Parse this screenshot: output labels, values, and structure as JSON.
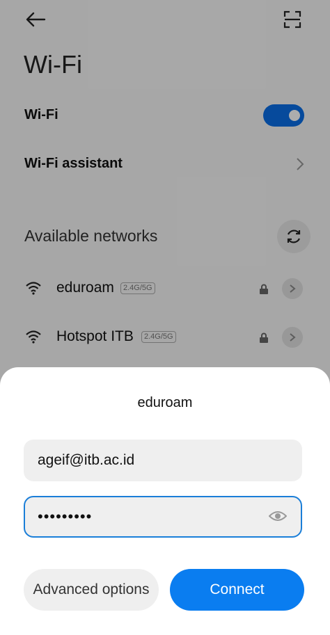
{
  "header": {
    "title": "Wi-Fi"
  },
  "settings": {
    "wifi_label": "Wi-Fi",
    "wifi_enabled": true,
    "assistant_label": "Wi-Fi assistant"
  },
  "networks": {
    "section_label": "Available networks",
    "items": [
      {
        "name": "eduroam",
        "band": "2.4G/5G",
        "secured": true
      },
      {
        "name": "Hotspot ITB",
        "band": "2.4G/5G",
        "secured": true
      }
    ]
  },
  "dialog": {
    "title": "eduroam",
    "identity_value": "ageif@itb.ac.id",
    "password_value": "•••••••••",
    "advanced_label": "Advanced options",
    "connect_label": "Connect"
  },
  "colors": {
    "accent": "#0a7df0",
    "field_focus_border": "#1a7ed8"
  }
}
